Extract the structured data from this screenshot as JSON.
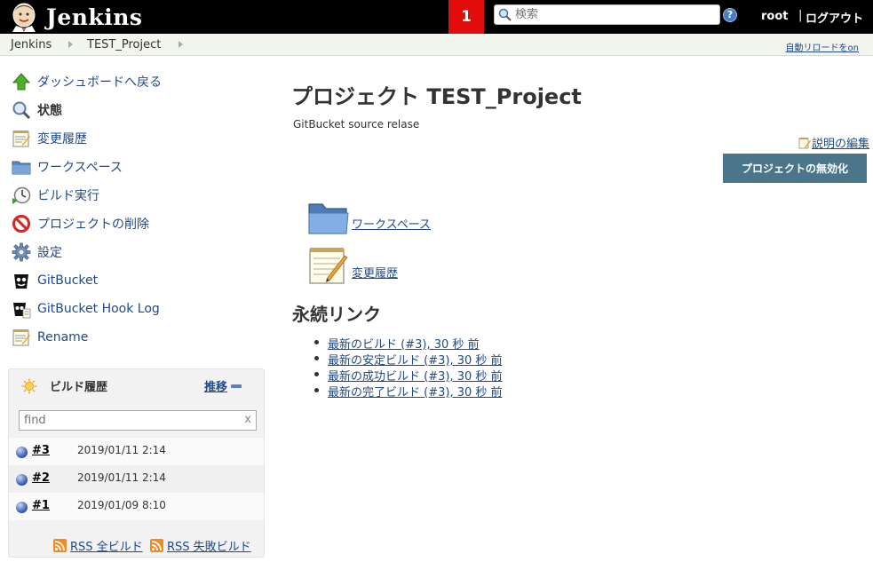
{
  "header": {
    "logo_text": "Jenkins",
    "alert_count": "1",
    "search_placeholder": "検索",
    "help_label": "?",
    "user": "root",
    "separator": "|",
    "logout": "ログアウト"
  },
  "breadcrumb": {
    "items": [
      "Jenkins",
      "TEST_Project"
    ],
    "autorefresh": "自動リロードをon"
  },
  "sidebar": {
    "tasks": [
      {
        "label": "ダッシュボードへ戻る",
        "icon": "up-arrow-icon"
      },
      {
        "label": "状態",
        "icon": "magnifier-icon",
        "current": true
      },
      {
        "label": "変更履歴",
        "icon": "notepad-icon"
      },
      {
        "label": "ワークスペース",
        "icon": "folder-icon"
      },
      {
        "label": "ビルド実行",
        "icon": "clock-icon"
      },
      {
        "label": "プロジェクトの削除",
        "icon": "no-entry-icon"
      },
      {
        "label": "設定",
        "icon": "gear-icon"
      },
      {
        "label": "GitBucket",
        "icon": "gitbucket-icon"
      },
      {
        "label": "GitBucket Hook Log",
        "icon": "gitbucket-hook-icon"
      },
      {
        "label": "Rename",
        "icon": "notepad-icon"
      }
    ]
  },
  "build_history": {
    "title": "ビルド履歴",
    "trend": "推移",
    "filter_placeholder": "find",
    "clear": "x",
    "builds": [
      {
        "number": "#3",
        "time": "2019/01/11 2:14",
        "status_color": "#4063b5"
      },
      {
        "number": "#2",
        "time": "2019/01/11 2:14",
        "status_color": "#4063b5"
      },
      {
        "number": "#1",
        "time": "2019/01/09 8:10",
        "status_color": "#4063b5"
      }
    ],
    "rss_all": "RSS 全ビルド",
    "rss_failed": "RSS 失敗ビルド"
  },
  "main": {
    "title": "プロジェクト TEST_Project",
    "description": "GitBucket source relase",
    "edit_description": "説明の編集",
    "disable_button": "プロジェクトの無効化",
    "links": [
      {
        "label": "ワークスペース",
        "icon": "folder-icon"
      },
      {
        "label": "変更履歴",
        "icon": "notepad-icon"
      }
    ],
    "permalinks_title": "永続リンク",
    "permalinks": [
      "最新のビルド (#3), 30 秒 前",
      "最新の安定ビルド (#3), 30 秒 前",
      "最新の成功ビルド (#3), 30 秒 前",
      "最新の完了ビルド (#3), 30 秒 前"
    ]
  },
  "colors": {
    "header_bg": "#000000",
    "alert_bg": "#e10d0d",
    "link": "#204a87",
    "button_bg": "#4b758b",
    "breadcrumb_bg": "#f2f4ee"
  }
}
